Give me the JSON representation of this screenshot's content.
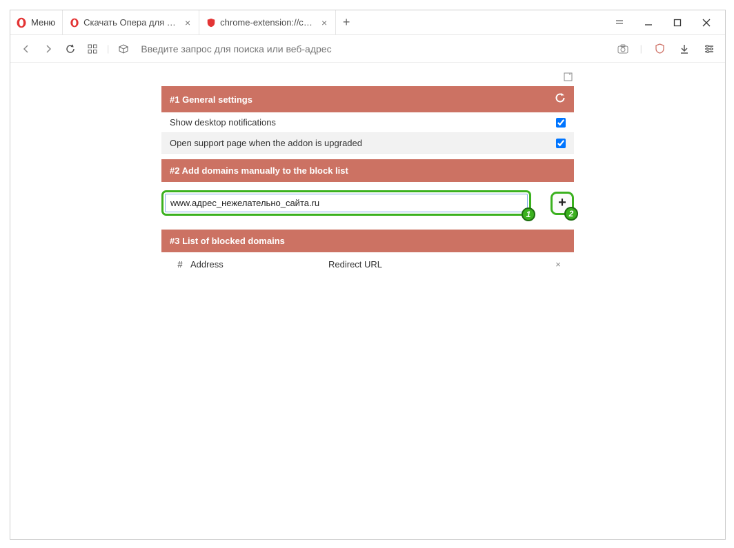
{
  "menu_label": "Меню",
  "tabs": [
    {
      "title": "Скачать Опера для компь",
      "favicon": "opera"
    },
    {
      "title": "chrome-extension://chnfki",
      "favicon": "shield"
    }
  ],
  "addressbar": {
    "placeholder": "Введите запрос для поиска или веб-адрес"
  },
  "sections": {
    "general": {
      "title": "#1 General settings",
      "rows": [
        {
          "label": "Show desktop notifications",
          "checked": true
        },
        {
          "label": "Open support page when the addon is upgraded",
          "checked": true
        }
      ]
    },
    "add_domains": {
      "title": "#2 Add domains manually to the block list",
      "input_value": "www.адрес_нежелательно_сайта.ru",
      "add_button_symbol": "+"
    },
    "list": {
      "title": "#3 List of blocked domains",
      "columns": {
        "hash": "#",
        "address": "Address",
        "redirect": "Redirect URL"
      }
    }
  },
  "annotations": {
    "badge1": "1",
    "badge2": "2"
  }
}
